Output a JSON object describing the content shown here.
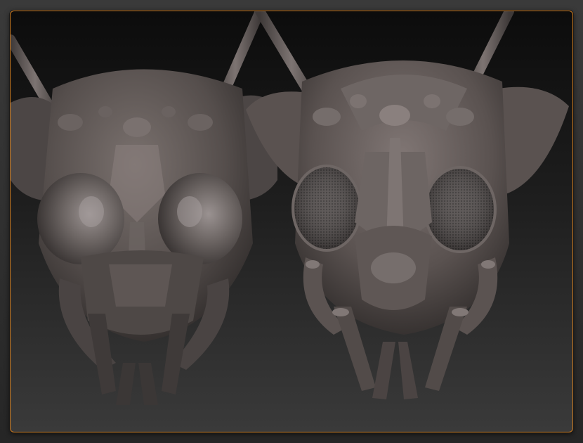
{
  "viewport": {
    "frame_color": "#c8781e",
    "background_top": "#0c0c0c",
    "background_bottom": "#3a3a3a"
  },
  "models": [
    {
      "variant": "low-detail",
      "material_color": "#5b5452"
    },
    {
      "variant": "high-detail",
      "material_color": "#5f5755"
    }
  ]
}
